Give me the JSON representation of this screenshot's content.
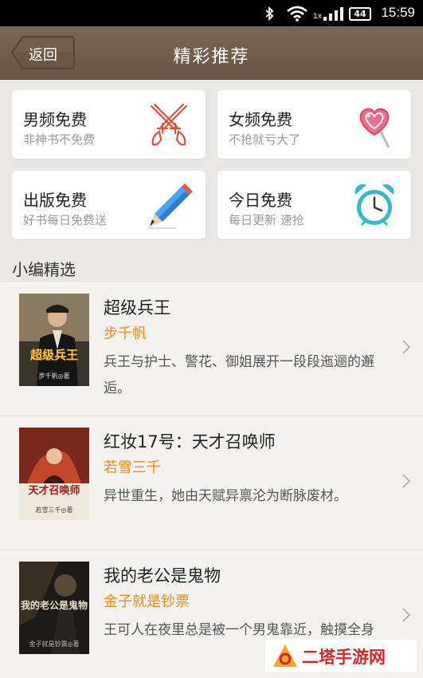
{
  "status_bar": {
    "time": "15:59",
    "battery": "44",
    "network": "1x"
  },
  "header": {
    "back_label": "返回",
    "title": "精彩推荐"
  },
  "categories": [
    {
      "title": "男频免费",
      "subtitle": "非神书不免费",
      "icon": "crossed-swords-icon"
    },
    {
      "title": "女频免费",
      "subtitle": "不抢就亏大了",
      "icon": "heart-lollipop-icon"
    },
    {
      "title": "出版免费",
      "subtitle": "好书每日免费送",
      "icon": "pencil-icon"
    },
    {
      "title": "今日免费",
      "subtitle": "每日更新 速抢",
      "icon": "alarm-clock-icon"
    }
  ],
  "section_title": "小编精选",
  "books": [
    {
      "title": "超级兵王",
      "author": "步千帆",
      "description": "兵王与护士、警花、御姐展开一段段迤逦的邂逅。",
      "cover_title": "超级兵王",
      "cover_author": "步千帆◎著"
    },
    {
      "title": "红妆17号：天才召唤师",
      "author": "若雪三千",
      "description": "异世重生，她由天赋异禀沦为断脉废材。",
      "cover_title": "天才召唤师",
      "cover_author": "若雪三千◎著"
    },
    {
      "title": "我的老公是鬼物",
      "author": "金子就是钞票",
      "description": "王可人在夜里总是被一个男鬼靠近，触摸全身",
      "cover_title": "我的老公是鬼物",
      "cover_author": "金子就是钞票◎著"
    }
  ],
  "watermark": "二塔手游网",
  "colors": {
    "header": "#6e5a49",
    "author": "#f08a1c",
    "watermark": "#d4262a"
  }
}
